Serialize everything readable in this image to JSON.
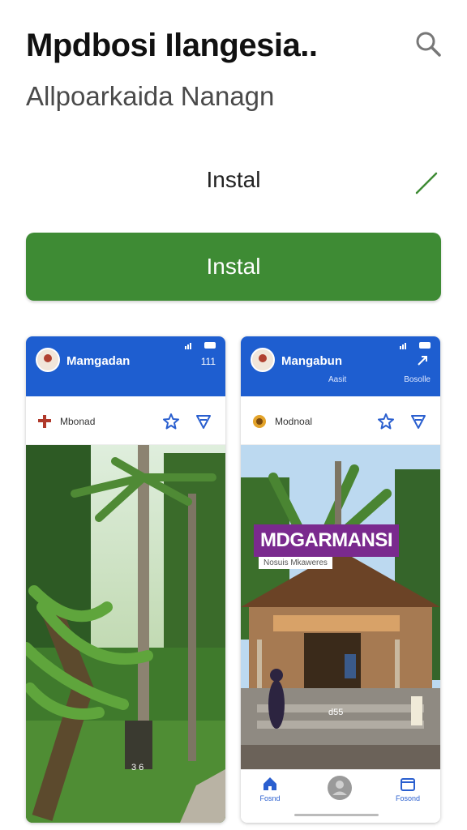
{
  "header": {
    "title": "Mpdbosi Ilangesia..",
    "subtitle": "Allpoarkaida Nanagn"
  },
  "install_row": {
    "text": "Instal"
  },
  "install_button": {
    "label": "Instal"
  },
  "colors": {
    "install_green": "#3e8b34",
    "app_blue": "#1e5ed0",
    "banner_purple": "#7a2a8e"
  },
  "screenshots": [
    {
      "header_title": "Mamgadan",
      "header_right": "111",
      "toolbar_label": "Mbonad",
      "photo_label": "3 6"
    },
    {
      "header_title": "Mangabun",
      "header_sub": "Aasit",
      "header_sub2": "Bosolle",
      "toolbar_label": "Modnoal",
      "banner_title": "MDGARMANSI",
      "banner_sub": "Nosuis Mkaweres",
      "photo_label": "d55",
      "nav_home_label": "Fosnd",
      "nav_right_label": "Fosond"
    }
  ],
  "icons": [
    "search-icon",
    "check-icon",
    "star-icon",
    "filter-icon",
    "home-icon",
    "profile-icon",
    "calendar-icon"
  ]
}
